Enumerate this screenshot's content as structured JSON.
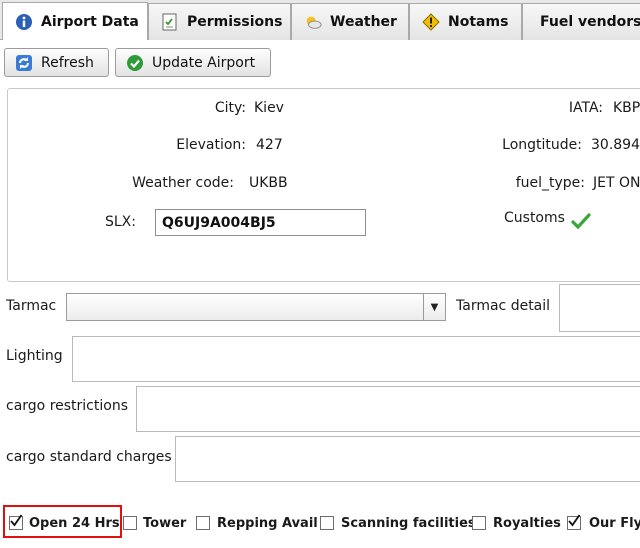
{
  "tabs": [
    {
      "label": "Airport Data",
      "icon": "info-icon",
      "active": true
    },
    {
      "label": "Permissions",
      "icon": "document-icon",
      "active": false
    },
    {
      "label": "Weather",
      "icon": "weather-icon",
      "active": false
    },
    {
      "label": "Notams",
      "icon": "warning-icon",
      "active": false
    },
    {
      "label": "Fuel vendors",
      "icon": "",
      "active": false
    }
  ],
  "toolbar": {
    "refresh_label": "Refresh",
    "update_label": "Update Airport"
  },
  "info": {
    "city_label": "City:",
    "city_value": "Kiev",
    "iata_label": "IATA:",
    "iata_value": "KBP",
    "elevation_label": "Elevation:",
    "elevation_value": "427",
    "longitude_label": "Longtitude:",
    "longitude_value": "30.894",
    "weather_code_label": "Weather code:",
    "weather_code_value": "UKBB",
    "fuel_type_label": "fuel_type:",
    "fuel_type_value": "JET ON",
    "slx_label": "SLX:",
    "slx_value": "Q6UJ9A004BJ5",
    "customs_label": "Customs",
    "customs_checked": true
  },
  "form": {
    "tarmac_label": "Tarmac",
    "tarmac_value": "",
    "tarmac_detail_label": "Tarmac detail",
    "lighting_label": "Lighting",
    "cargo_restrictions_label": "cargo restrictions",
    "cargo_charges_label": "cargo standard charges"
  },
  "checkboxes": [
    {
      "label": "Open 24 Hrs",
      "checked": true
    },
    {
      "label": "Tower",
      "checked": false
    },
    {
      "label": "Repping Avail",
      "checked": false
    },
    {
      "label": "Scanning facilities",
      "checked": false
    },
    {
      "label": "Royalties",
      "checked": false
    },
    {
      "label": "Our Flyi",
      "checked": true
    }
  ],
  "colors": {
    "highlight": "#e01010",
    "check_green": "#3aa63a"
  }
}
